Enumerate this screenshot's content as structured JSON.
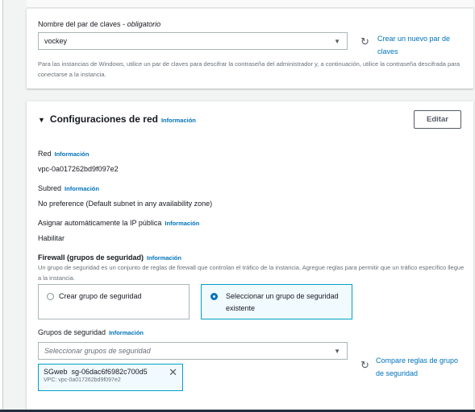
{
  "keypair": {
    "label": "Nombre del par de claves",
    "required": "obligatorio",
    "value": "vockey",
    "create_link": "Crear un nuevo par de claves",
    "help": "Para las instancias de Windows, utilice un par de claves para descifrar la contraseña del administrador y, a continuación, utilice la contraseña descifrada para conectarse a la instancia."
  },
  "network": {
    "title": "Configuraciones de red",
    "info": "Información",
    "edit_button": "Editar",
    "vpc_label": "Red",
    "vpc_value": "vpc-0a017262bd9f097e2",
    "subnet_label": "Subred",
    "subnet_value": "No preference (Default subnet in any availability zone)",
    "public_ip_label": "Asignar automáticamente la IP pública",
    "public_ip_value": "Habilitar",
    "firewall_label": "Firewall (grupos de seguridad)",
    "firewall_help": "Un grupo de seguridad es un conjunto de reglas de firewall que controlan el tráfico de la instancia. Agregue reglas para permitir que un tráfico específico llegue a la instancia.",
    "option_create": "Crear grupo de seguridad",
    "option_select": "Seleccionar un grupo de seguridad existente",
    "sg_label": "Grupos de seguridad",
    "sg_placeholder": "Seleccionar grupos de seguridad",
    "compare_link": "Compare reglas de grupo de seguridad",
    "token_name": "SGweb",
    "token_id": "sg-06dac6f6982c700d5",
    "token_vpc": "VPC: vpc-0a017262bd9f097e2"
  }
}
